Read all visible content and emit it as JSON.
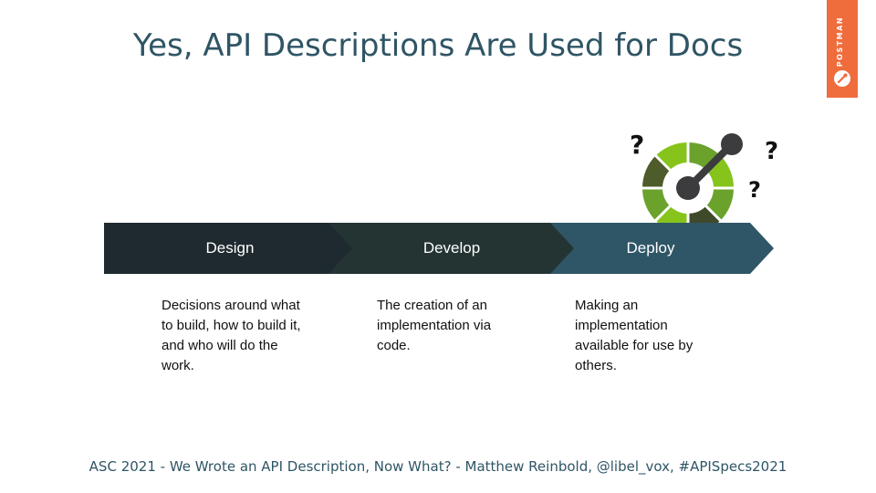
{
  "slide": {
    "title": "Yes, API Descriptions Are Used for Docs",
    "footer": "ASC 2021 - We Wrote an API Description, Now What? - Matthew Reinbold, @libel_vox, #APISpecs2021"
  },
  "brand": {
    "name": "POSTMAN",
    "color": "#ef6c3c"
  },
  "stages": [
    {
      "label": "Design",
      "description": [
        "Decisions around what",
        "to build, how to build it,",
        "and who will do the",
        "work."
      ],
      "color": "#1f2a30"
    },
    {
      "label": "Develop",
      "description": [
        "The creation of an",
        "implementation via",
        "code."
      ],
      "color": "#233433"
    },
    {
      "label": "Deploy",
      "description": [
        "Making an",
        "implementation",
        "available for use by",
        "others."
      ],
      "color": "#2f5667"
    }
  ],
  "logo": {
    "icon": "openapi-logo-icon",
    "marks": [
      "?",
      "?",
      "?"
    ],
    "colors": [
      "#3f4a2a",
      "#6aa22c",
      "#86c41c",
      "#4e5b2a",
      "#3c3c3f"
    ]
  }
}
